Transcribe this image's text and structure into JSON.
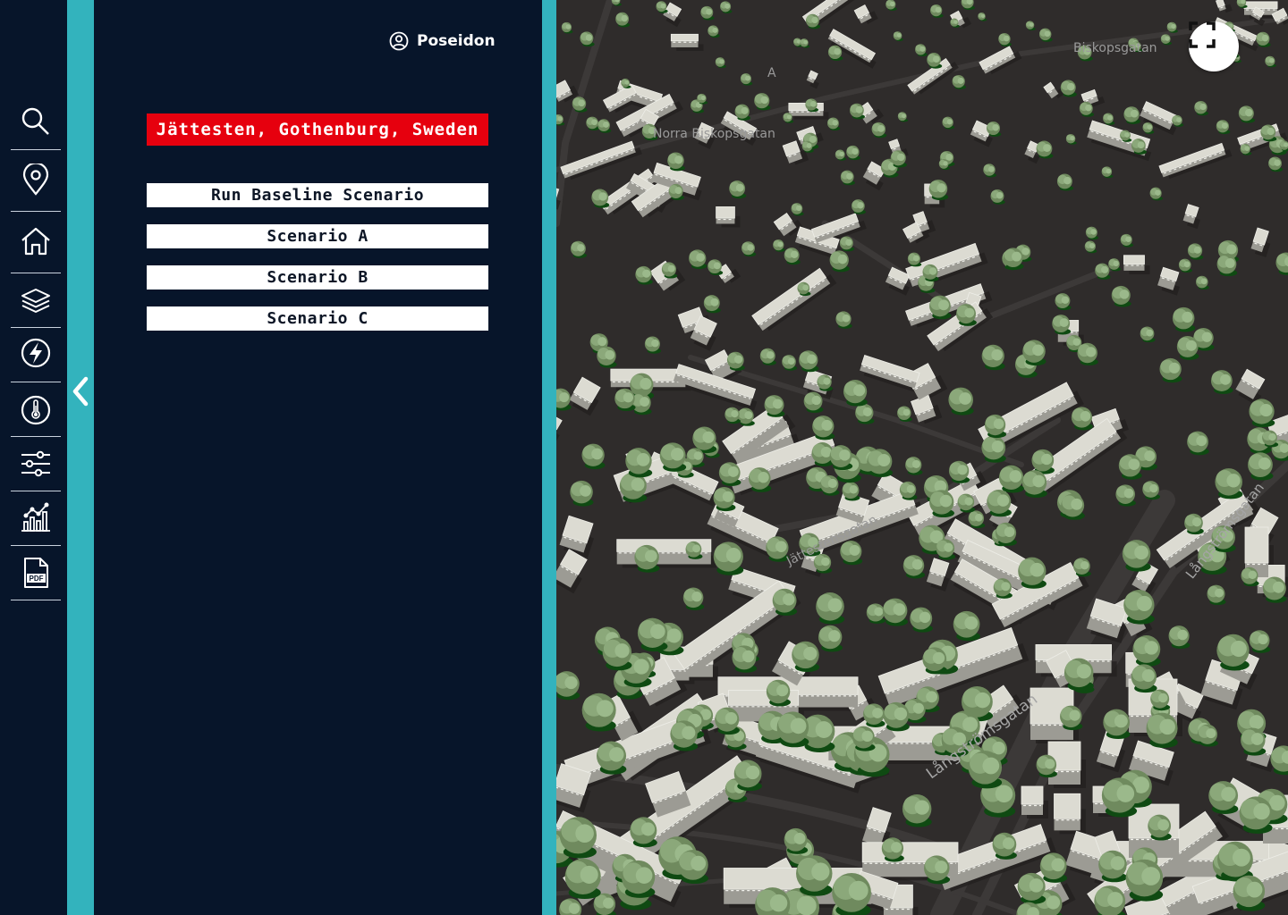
{
  "sidebar": {
    "items": [
      {
        "icon": "search-icon"
      },
      {
        "icon": "map-pin-icon"
      },
      {
        "icon": "home-icon"
      },
      {
        "icon": "layers-icon"
      },
      {
        "icon": "energy-icon"
      },
      {
        "icon": "thermometer-icon"
      },
      {
        "icon": "sliders-icon"
      },
      {
        "icon": "chart-icon"
      },
      {
        "icon": "pdf-icon"
      }
    ]
  },
  "panel": {
    "user_name": "Poseidon",
    "location": "Jättesten, Gothenburg, Sweden",
    "scenarios": [
      "Run Baseline Scenario",
      "Scenario A",
      "Scenario B",
      "Scenario C"
    ]
  },
  "map": {
    "street_labels": [
      "Långströmsgatan",
      "Långströmsgatan",
      "Jättestensgatan",
      "Norra Biskopsgatan",
      "Biskopsgatan",
      "A"
    ]
  },
  "colors": {
    "background": "#07152a",
    "accent_teal": "#33b3bd",
    "location_red": "#e6000e",
    "map_ground": "#2f2c2b"
  }
}
